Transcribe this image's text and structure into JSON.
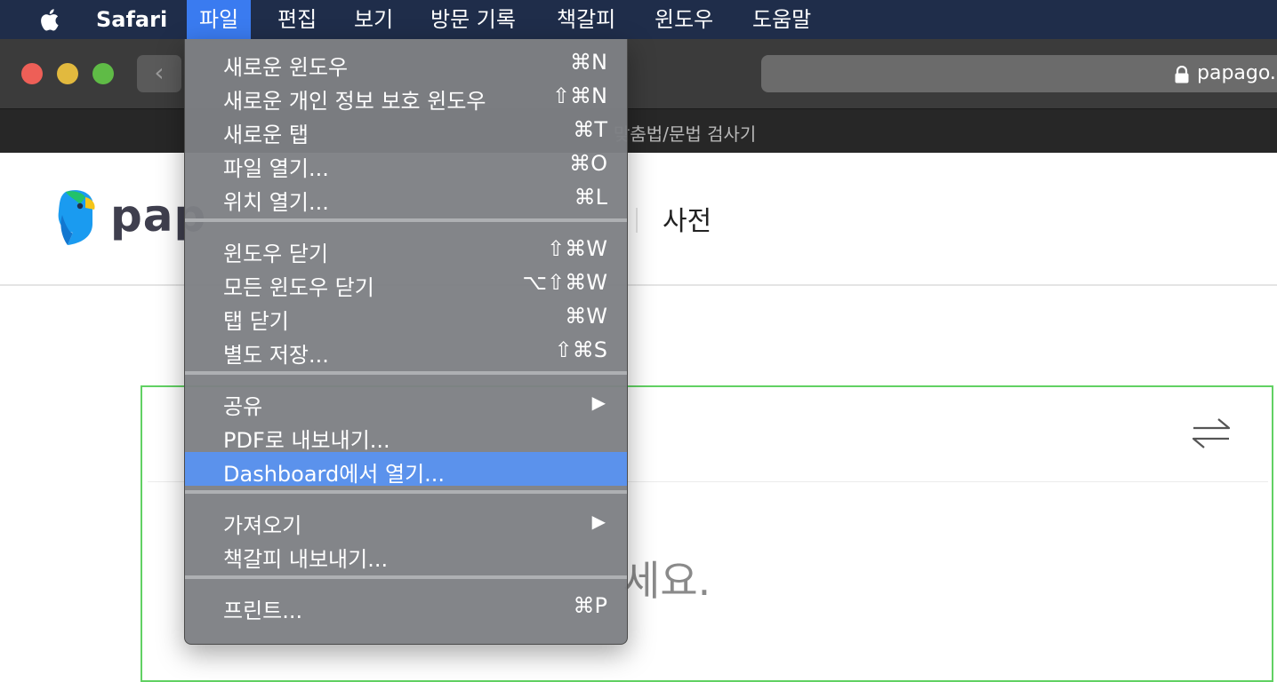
{
  "menubar": {
    "app_name": "Safari",
    "items": [
      "파일",
      "편집",
      "보기",
      "방문 기록",
      "책갈피",
      "윈도우",
      "도움말"
    ]
  },
  "browser": {
    "url": "papago.",
    "tab_title": "맞춤법/문법 검사기"
  },
  "page": {
    "logo_text": "pap",
    "nav_dictionary": "사전",
    "placeholder_right": "세요."
  },
  "file_menu": {
    "groups": [
      [
        {
          "label": "새로운 윈도우",
          "shortcut": "⌘N"
        },
        {
          "label": "새로운 개인 정보 보호 윈도우",
          "shortcut": "⇧⌘N"
        },
        {
          "label": "새로운 탭",
          "shortcut": "⌘T"
        },
        {
          "label": "파일 열기...",
          "shortcut": "⌘O"
        },
        {
          "label": "위치 열기...",
          "shortcut": "⌘L"
        }
      ],
      [
        {
          "label": "윈도우 닫기",
          "shortcut": "⇧⌘W"
        },
        {
          "label": "모든 윈도우 닫기",
          "shortcut": "⌥⇧⌘W"
        },
        {
          "label": "탭 닫기",
          "shortcut": "⌘W"
        },
        {
          "label": "별도 저장...",
          "shortcut": "⇧⌘S"
        }
      ],
      [
        {
          "label": "공유",
          "submenu": true
        },
        {
          "label": "PDF로 내보내기..."
        },
        {
          "label": "Dashboard에서 열기...",
          "highlighted": true
        }
      ],
      [
        {
          "label": "가져오기",
          "submenu": true
        },
        {
          "label": "책갈피 내보내기..."
        }
      ],
      [
        {
          "label": "프린트...",
          "shortcut": "⌘P"
        }
      ]
    ]
  },
  "colors": {
    "menubar_bg": "#1f2d4a",
    "menu_highlight": "#5b92ec",
    "translator_border": "#61d163"
  }
}
